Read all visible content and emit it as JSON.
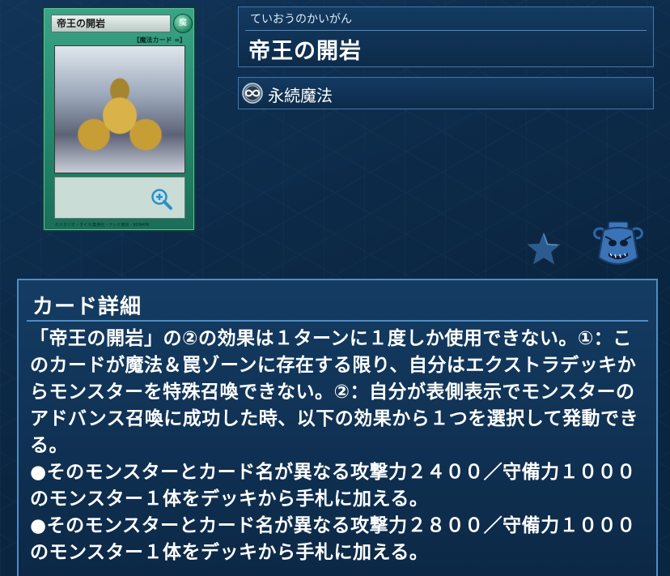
{
  "card": {
    "name_on_card": "帝王の開岩",
    "attribute_symbol": "魔",
    "type_line": "【魔法カード",
    "type_line_icon": "continuous-icon",
    "copyright": "©スタジオ・ダイス/集英社・テレビ東京・KONAMI"
  },
  "header": {
    "ruby": "ていおうのかいがん",
    "title": "帝王の開岩"
  },
  "type": {
    "icon": "infinity-continuous-icon",
    "label": "永続魔法"
  },
  "actions": {
    "favorite_icon": "star-icon",
    "deck_icon": "pot-icon"
  },
  "detail": {
    "heading": "カード詳細",
    "effect": "「帝王の開岩」の②の効果は１ターンに１度しか使用できない。①：このカードが魔法＆罠ゾーンに存在する限り、自分はエクストラデッキからモンスターを特殊召喚できない。②：自分が表側表示でモンスターのアドバンス召喚に成功した時、以下の効果から１つを選択して発動できる。\n●そのモンスターとカード名が異なる攻撃力２４００／守備力１０００のモンスター１体をデッキから手札に加える。\n●そのモンスターとカード名が異なる攻撃力２８００／守備力１０００のモンスター１体をデッキから手札に加える。"
  },
  "colors": {
    "background": "#0a2540",
    "panel_border": "#4f8cc3",
    "spell_card_green": "#23876b"
  }
}
